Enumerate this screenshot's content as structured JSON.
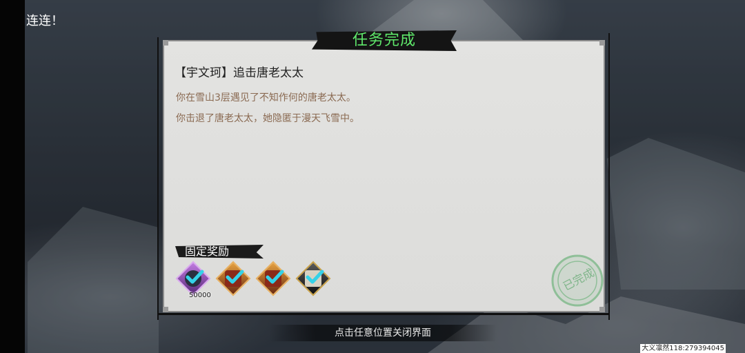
{
  "top_left_text": "连连！",
  "dialog": {
    "title": "任务完成",
    "quest_title": "【宇文珂】追击唐老太太",
    "desc_lines": [
      "你在雪山3层遇见了不知作何的唐老太太。",
      "你击退了唐老太太，她隐匿于漫天飞雪中。"
    ],
    "reward_label": "固定奖励",
    "rewards": [
      {
        "icon": "purple-item-icon",
        "count": "50000",
        "color": "#7a3a9a"
      },
      {
        "icon": "treasure-chest-icon",
        "color": "#9a3a20"
      },
      {
        "icon": "treasure-chest-icon",
        "color": "#9a3a20"
      },
      {
        "icon": "book-icon",
        "color": "#333333"
      }
    ],
    "stamp_text": "已完成",
    "check_color": "#35d2e8"
  },
  "hint": "点击任意位置关闭界面",
  "user_id": "大义凛然118:279394045"
}
